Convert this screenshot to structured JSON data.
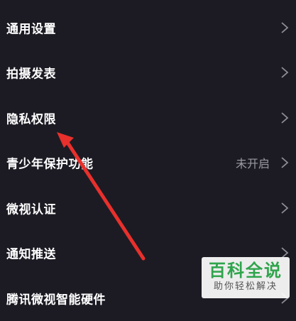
{
  "settings": {
    "items": [
      {
        "label": "通用设置",
        "value": ""
      },
      {
        "label": "拍摄发表",
        "value": ""
      },
      {
        "label": "隐私权限",
        "value": ""
      },
      {
        "label": "青少年保护功能",
        "value": "未开启"
      },
      {
        "label": "微视认证",
        "value": ""
      },
      {
        "label": "通知推送",
        "value": ""
      },
      {
        "label": "腾讯微视智能硬件",
        "value": ""
      }
    ]
  },
  "watermark": {
    "main": "百科全说",
    "sub": "助你轻松解决"
  },
  "colors": {
    "background": "#1c1b23",
    "text": "#ffffff",
    "secondary_text": "#9a9aa3",
    "chevron": "#8e8e95",
    "arrow": "#e8302c",
    "watermark_green": "#2fa44c"
  },
  "icons": {
    "row_chevron": "chevron-right-icon"
  }
}
